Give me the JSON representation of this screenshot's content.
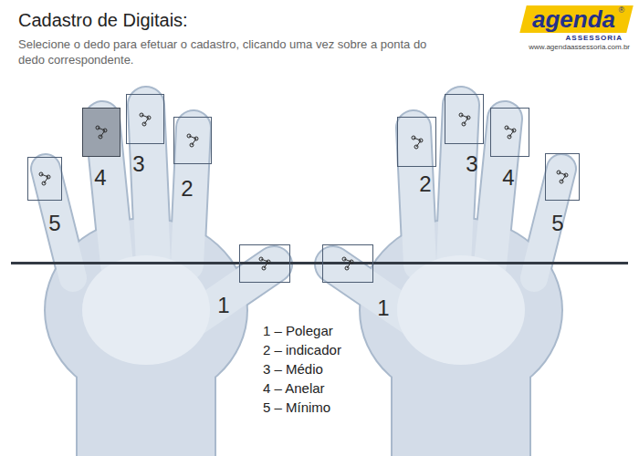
{
  "title": "Cadastro de Digitais:",
  "instructions": "Selecione o dedo para efetuar o cadastro, clicando uma vez sobre a ponta do dedo correspondente.",
  "logo": {
    "name": "agenda",
    "registered": "®",
    "tagline": "ASSESSORIA",
    "url": "www.agendaassessoria.com.br"
  },
  "hands": [
    {
      "side": "left",
      "fingers": [
        {
          "number": "5",
          "selected": false
        },
        {
          "number": "4",
          "selected": true
        },
        {
          "number": "3",
          "selected": false
        },
        {
          "number": "2",
          "selected": false
        },
        {
          "number": "1",
          "selected": false
        }
      ]
    },
    {
      "side": "right",
      "fingers": [
        {
          "number": "1",
          "selected": false
        },
        {
          "number": "2",
          "selected": false
        },
        {
          "number": "3",
          "selected": false
        },
        {
          "number": "4",
          "selected": false
        },
        {
          "number": "5",
          "selected": false
        }
      ]
    }
  ],
  "legend": [
    "1 – Polegar",
    "2 – indicador",
    "3 – Médio",
    "4 – Anelar",
    "5 – Mínimo"
  ]
}
